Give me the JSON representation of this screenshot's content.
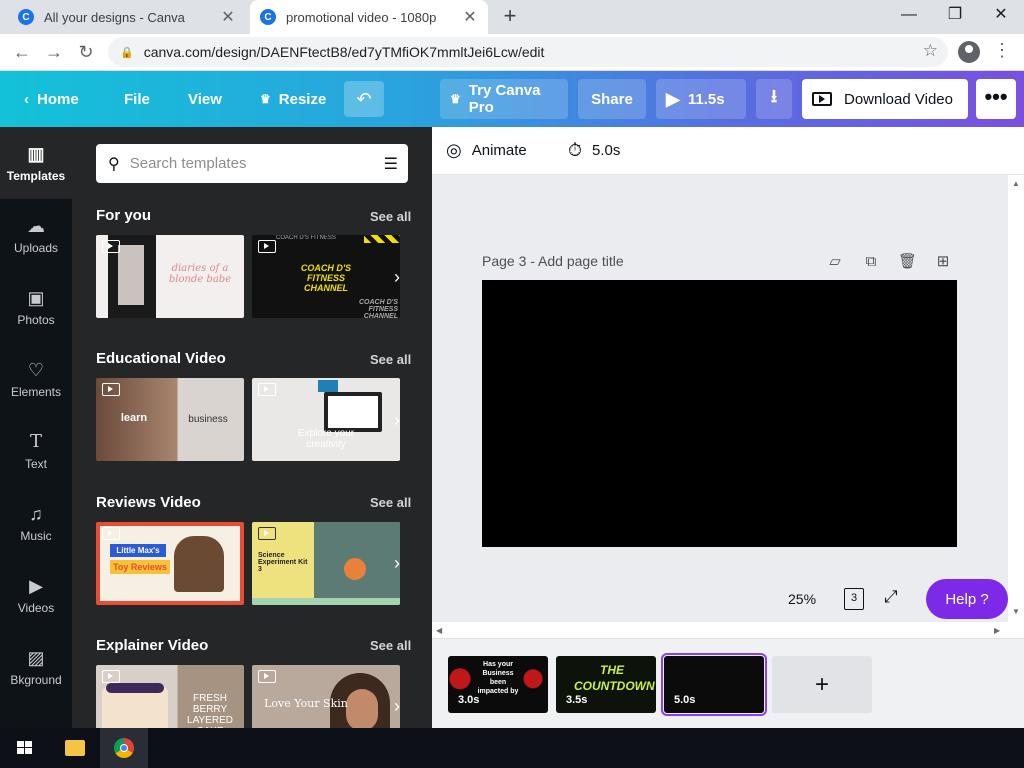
{
  "browser": {
    "tabs": [
      {
        "title": "All your designs - Canva",
        "favicon": "C"
      },
      {
        "title": "promotional video - 1080p",
        "favicon": "C"
      }
    ],
    "url": "canva.com/design/DAENFtectB8/ed7yTMfiOK7mmltJei6Lcw/edit"
  },
  "header": {
    "home": "Home",
    "file": "File",
    "view": "View",
    "resize": "Resize",
    "try_pro": "Try Canva Pro",
    "share": "Share",
    "play_duration": "11.5s",
    "download_video": "Download Video",
    "more": "•••"
  },
  "rail": {
    "items": [
      {
        "label": "Templates",
        "icon": "templates-icon"
      },
      {
        "label": "Uploads",
        "icon": "cloud-upload-icon"
      },
      {
        "label": "Photos",
        "icon": "image-icon"
      },
      {
        "label": "Elements",
        "icon": "shapes-icon"
      },
      {
        "label": "Text",
        "icon": "text-icon"
      },
      {
        "label": "Music",
        "icon": "music-note-icon"
      },
      {
        "label": "Videos",
        "icon": "video-icon"
      },
      {
        "label": "Bkground",
        "icon": "background-pattern-icon"
      }
    ]
  },
  "panel": {
    "search_placeholder": "Search templates",
    "see_all": "See all",
    "sections": [
      {
        "title": "For you",
        "thumbs": [
          {
            "text": "diaries of a blonde babe"
          },
          {
            "text": "COACH D'S FITNESS CHANNEL",
            "sub": "COACH D'S FITNESS",
            "sub2": "COACH D'S FITNESS CHANNEL"
          }
        ]
      },
      {
        "title": "Educational Video",
        "thumbs": [
          {
            "text": "learn",
            "sub": "business"
          },
          {
            "text": "Explore your creativity"
          }
        ]
      },
      {
        "title": "Reviews Video",
        "thumbs": [
          {
            "text": "Little Max's",
            "sub": "Toy Reviews"
          },
          {
            "text": "Science Experiment Kit 3"
          }
        ]
      },
      {
        "title": "Explainer Video",
        "thumbs": [
          {
            "text": "FRESH BERRY LAYERED CAKE"
          },
          {
            "text": "Love Your Skin"
          }
        ]
      }
    ]
  },
  "toolbar": {
    "animate": "Animate",
    "duration": "5.0s"
  },
  "canvas": {
    "page_title": "Page 3 - Add page title"
  },
  "zoom": {
    "percent": "25%",
    "page_count": "3"
  },
  "help": "Help ?",
  "timeline": {
    "clips": [
      {
        "duration": "3.0s",
        "caption": "Has your Business been impacted by"
      },
      {
        "duration": "3.5s",
        "caption": "THE COUNTDOWN?"
      },
      {
        "duration": "5.0s",
        "caption": ""
      }
    ],
    "add": "+"
  },
  "colors": {
    "accent_purple": "#7d2ae8",
    "header_gradient_start": "#13c2d8",
    "header_gradient_end": "#7a4fe0",
    "panel_bg": "#252627",
    "rail_bg": "#0e1318"
  }
}
